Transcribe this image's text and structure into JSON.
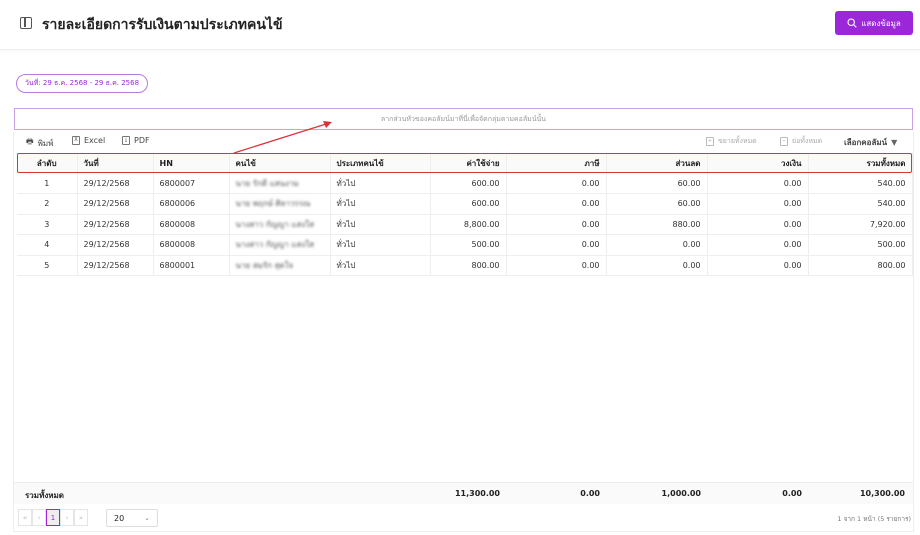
{
  "header": {
    "title": "รายละเอียดการรับเงินตามประเภทคนไข้",
    "show_button": "แสดงข้อมูล"
  },
  "filter": {
    "date_range": "วันที่: 29 ธ.ค. 2568 - 29 ธ.ค. 2568"
  },
  "group_area": {
    "placeholder": "ลากส่วนหัวของคอลัมน์มาที่นี่เพื่อจัดกลุ่มตามคอลัมน์นั้น"
  },
  "toolbar": {
    "print": "พิมพ์",
    "excel": "Excel",
    "pdf": "PDF",
    "expand_all": "ขยายทั้งหมด",
    "collapse_all": "ย่อทั้งหมด",
    "choose_columns": "เลือกคอลัมน์"
  },
  "table": {
    "columns": [
      "ลำดับ",
      "วันที่",
      "HN",
      "คนไข้",
      "ประเภทคนไข้",
      "ค่าใช้จ่าย",
      "ภาษี",
      "ส่วนลด",
      "วงเงิน",
      "รวมทั้งหมด"
    ],
    "rows": [
      [
        "1",
        "29/12/2568",
        "6800007",
        "นาย รักดี แสนงาม",
        "ทั่วไป",
        "600.00",
        "0.00",
        "60.00",
        "0.00",
        "540.00"
      ],
      [
        "2",
        "29/12/2568",
        "6800006",
        "นาย พฤกษ์ ศิลาวรรณ",
        "ทั่วไป",
        "600.00",
        "0.00",
        "60.00",
        "0.00",
        "540.00"
      ],
      [
        "3",
        "29/12/2568",
        "6800008",
        "นางสาว กัญญา แสงใส",
        "ทั่วไป",
        "8,800.00",
        "0.00",
        "880.00",
        "0.00",
        "7,920.00"
      ],
      [
        "4",
        "29/12/2568",
        "6800008",
        "นางสาว กัญญา แสงใส",
        "ทั่วไป",
        "500.00",
        "0.00",
        "0.00",
        "0.00",
        "500.00"
      ],
      [
        "5",
        "29/12/2568",
        "6800001",
        "นาย สมรัก สุดใจ",
        "ทั่วไป",
        "800.00",
        "0.00",
        "0.00",
        "0.00",
        "800.00"
      ]
    ],
    "totals": {
      "label": "รวมทั้งหมด",
      "expense": "11,300.00",
      "tax": "0.00",
      "discount": "1,000.00",
      "credit": "0.00",
      "total": "10,300.00"
    }
  },
  "pagination": {
    "current_page": "1",
    "page_size": "20",
    "info": "1 จาก 1 หน้า (5 รายการ)"
  },
  "colors": {
    "accent": "#9b27d9",
    "annotation": "#d9343a"
  }
}
